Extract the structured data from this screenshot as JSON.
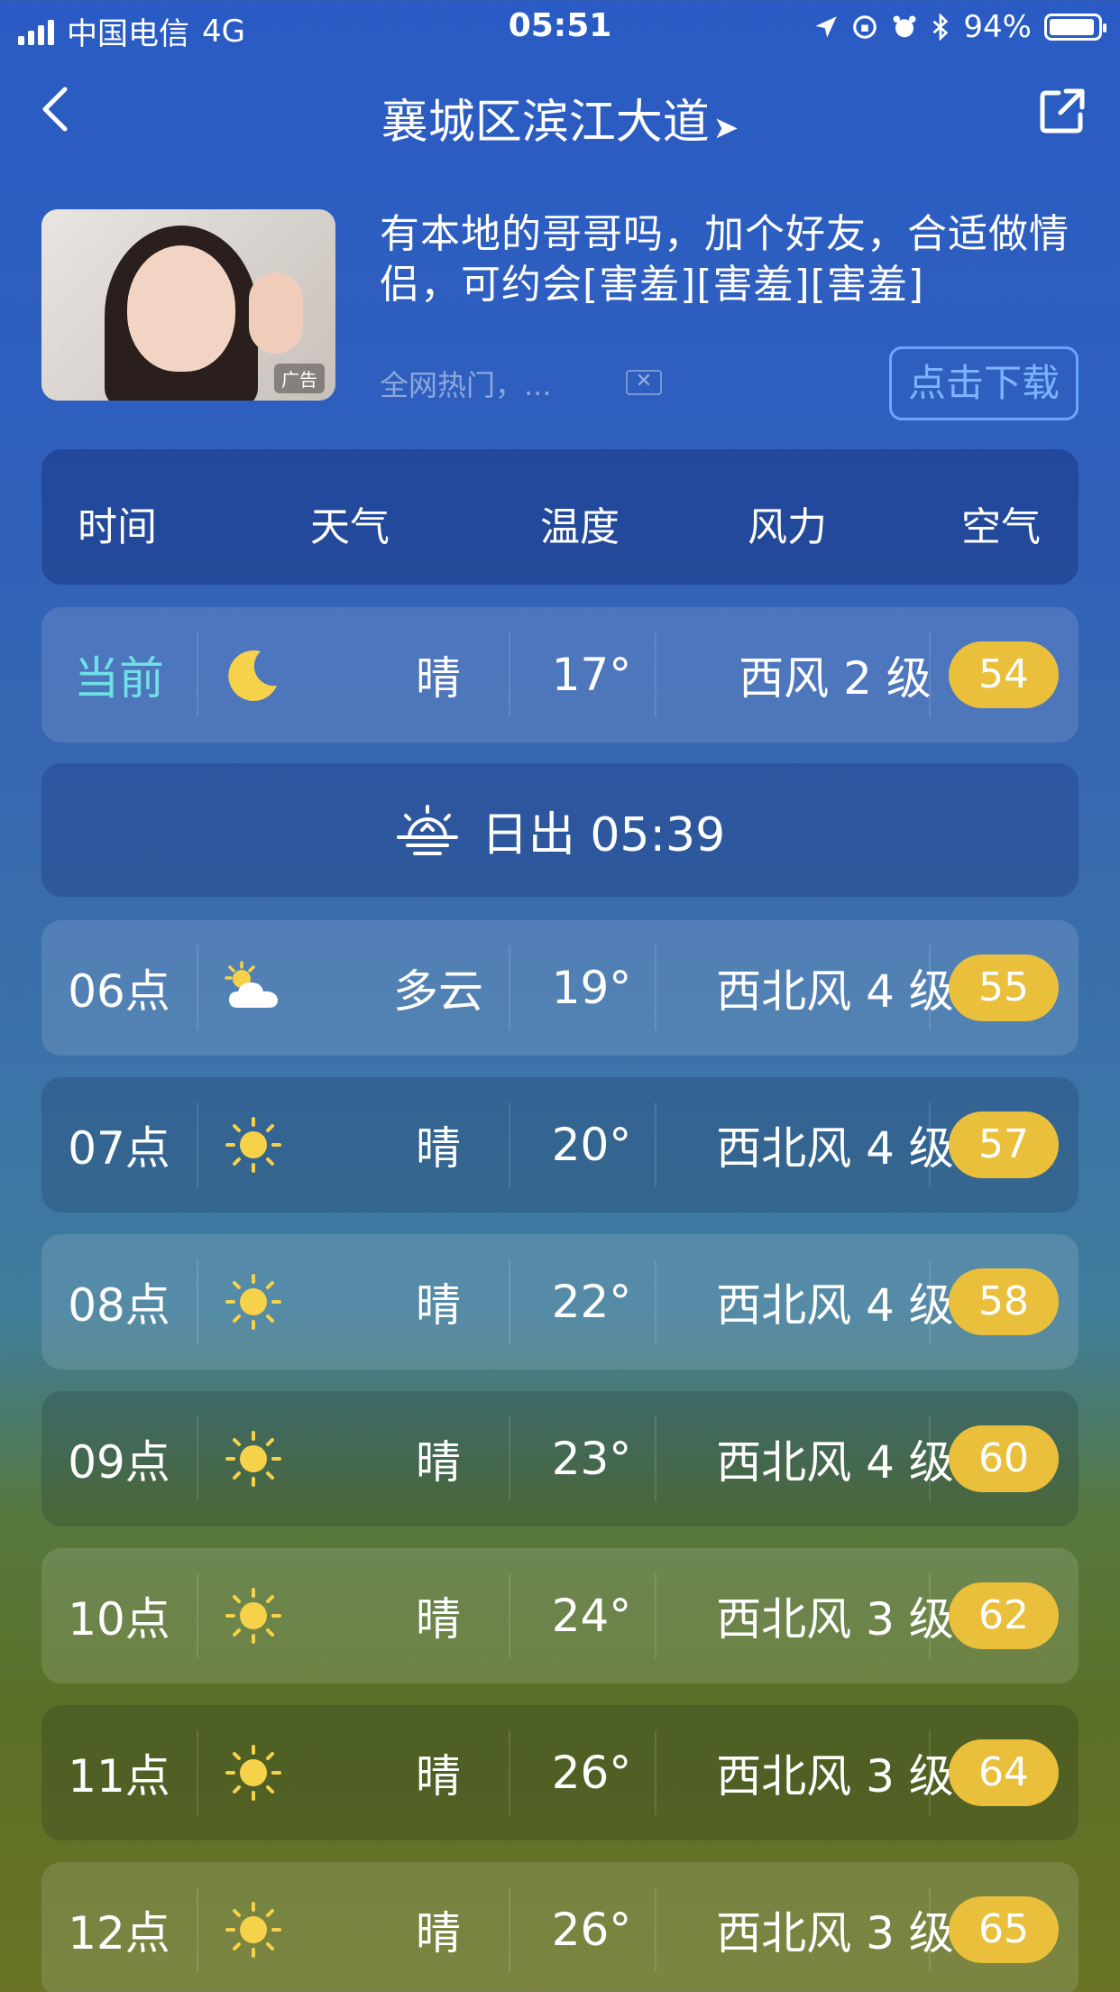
{
  "status_bar": {
    "carrier": "中国电信",
    "network": "4G",
    "time": "05:51",
    "battery": "94%",
    "battery_level": 0.94,
    "icons": [
      "location-arrow-icon",
      "orientation-lock-icon",
      "alarm-icon",
      "bluetooth-icon",
      "battery-icon"
    ]
  },
  "nav": {
    "back_icon": "chevron-left-icon",
    "title": "襄城区滨江大道",
    "location_icon": "location-arrow-icon",
    "share_icon": "share-icon"
  },
  "ad": {
    "headline": "有本地的哥哥吗，加个好友，合适做情侣，可约会[害羞][害羞][害羞]",
    "badge": "广告",
    "source": "全网热门，...",
    "close_icon": "close-icon",
    "cta": "点击下载"
  },
  "table": {
    "headers": [
      "时间",
      "天气",
      "温度",
      "风力",
      "空气"
    ],
    "current": {
      "time": "当前",
      "icon": "moon-icon",
      "weather": "晴",
      "temp": "17°",
      "wind": "西风 2 级",
      "aqi": "54"
    },
    "sunrise": {
      "icon": "sunrise-icon",
      "text": "日出 05:39"
    },
    "rows": [
      {
        "time": "06点",
        "icon": "partly-cloudy-icon",
        "weather": "多云",
        "temp": "19°",
        "wind": "西北风 4 级",
        "aqi": "55"
      },
      {
        "time": "07点",
        "icon": "sun-icon",
        "weather": "晴",
        "temp": "20°",
        "wind": "西北风 4 级",
        "aqi": "57"
      },
      {
        "time": "08点",
        "icon": "sun-icon",
        "weather": "晴",
        "temp": "22°",
        "wind": "西北风 4 级",
        "aqi": "58"
      },
      {
        "time": "09点",
        "icon": "sun-icon",
        "weather": "晴",
        "temp": "23°",
        "wind": "西北风 4 级",
        "aqi": "60"
      },
      {
        "time": "10点",
        "icon": "sun-icon",
        "weather": "晴",
        "temp": "24°",
        "wind": "西北风 3 级",
        "aqi": "62"
      },
      {
        "time": "11点",
        "icon": "sun-icon",
        "weather": "晴",
        "temp": "26°",
        "wind": "西北风 3 级",
        "aqi": "64"
      },
      {
        "time": "12点",
        "icon": "sun-icon",
        "weather": "晴",
        "temp": "26°",
        "wind": "西北风 3 级",
        "aqi": "65"
      }
    ]
  },
  "colors": {
    "aqi_badge": "#e9bf3b",
    "current_label": "#6fe0e6",
    "cta_border": "#69a6ff"
  }
}
